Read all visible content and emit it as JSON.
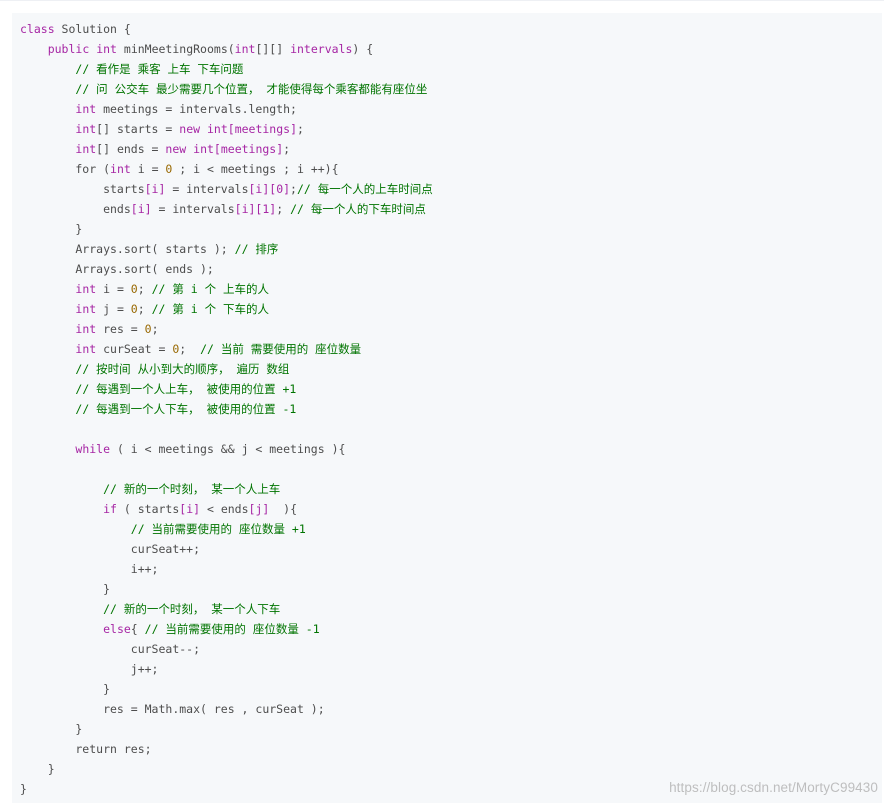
{
  "code": {
    "language": "java",
    "lines": [
      [
        {
          "t": "kw",
          "v": "class"
        },
        {
          "t": "pl",
          "v": " Solution {"
        }
      ],
      [
        {
          "t": "pl",
          "v": "    "
        },
        {
          "t": "kw",
          "v": "public"
        },
        {
          "t": "pl",
          "v": " "
        },
        {
          "t": "ty",
          "v": "int"
        },
        {
          "t": "pl",
          "v": " minMeetingRooms("
        },
        {
          "t": "ty",
          "v": "int"
        },
        {
          "t": "pl",
          "v": "[][] "
        },
        {
          "t": "kw",
          "v": "intervals"
        },
        {
          "t": "pl",
          "v": ") {"
        }
      ],
      [
        {
          "t": "pl",
          "v": "        "
        },
        {
          "t": "cm",
          "v": "// 看作是 乘客 上车 下车问题"
        }
      ],
      [
        {
          "t": "pl",
          "v": "        "
        },
        {
          "t": "cm",
          "v": "// 问 公交车 最少需要几个位置， 才能使得每个乘客都能有座位坐"
        }
      ],
      [
        {
          "t": "pl",
          "v": "        "
        },
        {
          "t": "ty",
          "v": "int"
        },
        {
          "t": "pl",
          "v": " meetings = intervals.length;"
        }
      ],
      [
        {
          "t": "pl",
          "v": "        "
        },
        {
          "t": "ty",
          "v": "int"
        },
        {
          "t": "pl",
          "v": "[] starts = "
        },
        {
          "t": "kw",
          "v": "new"
        },
        {
          "t": "pl",
          "v": " "
        },
        {
          "t": "ty",
          "v": "int"
        },
        {
          "t": "kw",
          "v": "[meetings]"
        },
        {
          "t": "pl",
          "v": ";"
        }
      ],
      [
        {
          "t": "pl",
          "v": "        "
        },
        {
          "t": "ty",
          "v": "int"
        },
        {
          "t": "pl",
          "v": "[] ends = "
        },
        {
          "t": "kw",
          "v": "new"
        },
        {
          "t": "pl",
          "v": " "
        },
        {
          "t": "ty",
          "v": "int"
        },
        {
          "t": "kw",
          "v": "[meetings]"
        },
        {
          "t": "pl",
          "v": ";"
        }
      ],
      [
        {
          "t": "pl",
          "v": "        for ("
        },
        {
          "t": "ty",
          "v": "int"
        },
        {
          "t": "pl",
          "v": " i = "
        },
        {
          "t": "nu",
          "v": "0"
        },
        {
          "t": "pl",
          "v": " ; i < meetings ; i ++){"
        }
      ],
      [
        {
          "t": "pl",
          "v": "            starts"
        },
        {
          "t": "kw",
          "v": "[i]"
        },
        {
          "t": "pl",
          "v": " = intervals"
        },
        {
          "t": "kw",
          "v": "[i][0]"
        },
        {
          "t": "pl",
          "v": ";"
        },
        {
          "t": "cm",
          "v": "// 每一个人的上车时间点"
        }
      ],
      [
        {
          "t": "pl",
          "v": "            ends"
        },
        {
          "t": "kw",
          "v": "[i]"
        },
        {
          "t": "pl",
          "v": " = intervals"
        },
        {
          "t": "kw",
          "v": "[i][1]"
        },
        {
          "t": "pl",
          "v": "; "
        },
        {
          "t": "cm",
          "v": "// 每一个人的下车时间点"
        }
      ],
      [
        {
          "t": "pl",
          "v": "        }"
        }
      ],
      [
        {
          "t": "pl",
          "v": "        Arrays.sort( starts ); "
        },
        {
          "t": "cm",
          "v": "// 排序"
        }
      ],
      [
        {
          "t": "pl",
          "v": "        Arrays.sort( ends );"
        }
      ],
      [
        {
          "t": "pl",
          "v": "        "
        },
        {
          "t": "ty",
          "v": "int"
        },
        {
          "t": "pl",
          "v": " i = "
        },
        {
          "t": "nu",
          "v": "0"
        },
        {
          "t": "pl",
          "v": "; "
        },
        {
          "t": "cm",
          "v": "// 第 i 个 上车的人"
        }
      ],
      [
        {
          "t": "pl",
          "v": "        "
        },
        {
          "t": "ty",
          "v": "int"
        },
        {
          "t": "pl",
          "v": " j = "
        },
        {
          "t": "nu",
          "v": "0"
        },
        {
          "t": "pl",
          "v": "; "
        },
        {
          "t": "cm",
          "v": "// 第 i 个 下车的人"
        }
      ],
      [
        {
          "t": "pl",
          "v": "        "
        },
        {
          "t": "ty",
          "v": "int"
        },
        {
          "t": "pl",
          "v": " res = "
        },
        {
          "t": "nu",
          "v": "0"
        },
        {
          "t": "pl",
          "v": ";"
        }
      ],
      [
        {
          "t": "pl",
          "v": "        "
        },
        {
          "t": "ty",
          "v": "int"
        },
        {
          "t": "pl",
          "v": " curSeat = "
        },
        {
          "t": "nu",
          "v": "0"
        },
        {
          "t": "pl",
          "v": ";  "
        },
        {
          "t": "cm",
          "v": "// 当前 需要使用的 座位数量"
        }
      ],
      [
        {
          "t": "pl",
          "v": "        "
        },
        {
          "t": "cm",
          "v": "// 按时间 从小到大的顺序， 遍历 数组"
        }
      ],
      [
        {
          "t": "pl",
          "v": "        "
        },
        {
          "t": "cm",
          "v": "// 每遇到一个人上车， 被使用的位置 +1"
        }
      ],
      [
        {
          "t": "pl",
          "v": "        "
        },
        {
          "t": "cm",
          "v": "// 每遇到一个人下车， 被使用的位置 -1"
        }
      ],
      [
        {
          "t": "pl",
          "v": ""
        }
      ],
      [
        {
          "t": "pl",
          "v": "        "
        },
        {
          "t": "kw",
          "v": "while"
        },
        {
          "t": "pl",
          "v": " ( i < meetings && j < meetings ){"
        }
      ],
      [
        {
          "t": "pl",
          "v": ""
        }
      ],
      [
        {
          "t": "pl",
          "v": "            "
        },
        {
          "t": "cm",
          "v": "// 新的一个时刻， 某一个人上车"
        }
      ],
      [
        {
          "t": "pl",
          "v": "            "
        },
        {
          "t": "kw",
          "v": "if"
        },
        {
          "t": "pl",
          "v": " ( starts"
        },
        {
          "t": "kw",
          "v": "[i]"
        },
        {
          "t": "pl",
          "v": " < ends"
        },
        {
          "t": "kw",
          "v": "[j]"
        },
        {
          "t": "pl",
          "v": "  ){"
        }
      ],
      [
        {
          "t": "pl",
          "v": "                "
        },
        {
          "t": "cm",
          "v": "// 当前需要使用的 座位数量 +1"
        }
      ],
      [
        {
          "t": "pl",
          "v": "                curSeat++;"
        }
      ],
      [
        {
          "t": "pl",
          "v": "                i++;"
        }
      ],
      [
        {
          "t": "pl",
          "v": "            }"
        }
      ],
      [
        {
          "t": "pl",
          "v": "            "
        },
        {
          "t": "cm",
          "v": "// 新的一个时刻， 某一个人下车"
        }
      ],
      [
        {
          "t": "pl",
          "v": "            "
        },
        {
          "t": "kw",
          "v": "else"
        },
        {
          "t": "pl",
          "v": "{ "
        },
        {
          "t": "cm",
          "v": "// 当前需要使用的 座位数量 -1"
        }
      ],
      [
        {
          "t": "pl",
          "v": "                curSeat--;"
        }
      ],
      [
        {
          "t": "pl",
          "v": "                j++;"
        }
      ],
      [
        {
          "t": "pl",
          "v": "            }"
        }
      ],
      [
        {
          "t": "pl",
          "v": "            res = Math.max( res , curSeat );"
        }
      ],
      [
        {
          "t": "pl",
          "v": "        }"
        }
      ],
      [
        {
          "t": "pl",
          "v": "        return res;"
        }
      ],
      [
        {
          "t": "pl",
          "v": "    }"
        }
      ],
      [
        {
          "t": "pl",
          "v": "}"
        }
      ]
    ]
  },
  "colors": {
    "keyword": "#a626a4",
    "comment": "#007400",
    "number": "#986801",
    "plain": "#4d4d4d",
    "code_background": "#f6f8fa"
  },
  "watermark": "https://blog.csdn.net/MortyC99430"
}
